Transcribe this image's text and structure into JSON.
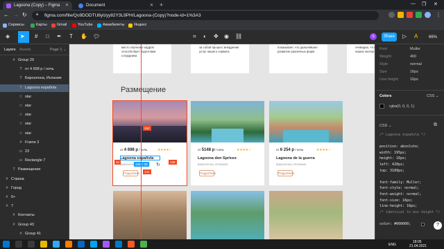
{
  "browser": {
    "tabs": [
      {
        "label": "Lagoona (Copy) – Figma",
        "active": true
      },
      {
        "label": "Document",
        "active": false
      }
    ],
    "new_tab": "+",
    "url": "figma.com/file/Qo9DODTU8ylzyy82Y3L9PH/Lagoona-(Copy)?node-id=1%3A3",
    "bookmarks": [
      "Сервисы",
      "Карты",
      "Gmail",
      "YouTube",
      "Авиабилеты",
      "Яндекс"
    ],
    "window_controls": [
      "—",
      "❐",
      "✕"
    ]
  },
  "figma": {
    "share_label": "Share",
    "zoom": "66%",
    "avatar_letter": "S"
  },
  "layers_panel": {
    "tab_layers": "Layers",
    "tab_assets": "Assets",
    "page": "Page 1 ⌄",
    "items": [
      {
        "icon": "#",
        "name": "Group 29",
        "indent": 1,
        "selected": false
      },
      {
        "icon": "T",
        "name": "от 4 698 р / ночь",
        "indent": 2,
        "selected": false
      },
      {
        "icon": "T",
        "name": "Барселона, Испания",
        "indent": 2,
        "selected": false
      },
      {
        "icon": "T",
        "name": "Lagoona españolа",
        "indent": 2,
        "selected": true
      },
      {
        "icon": "☆",
        "name": "star",
        "indent": 2,
        "selected": false
      },
      {
        "icon": "☆",
        "name": "star",
        "indent": 2,
        "selected": false
      },
      {
        "icon": "☆",
        "name": "star",
        "indent": 2,
        "selected": false
      },
      {
        "icon": "☆",
        "name": "star",
        "indent": 2,
        "selected": false
      },
      {
        "icon": "☆",
        "name": "star",
        "indent": 2,
        "selected": false
      },
      {
        "icon": "#",
        "name": "Frame 2",
        "indent": 2,
        "selected": false
      },
      {
        "icon": "▭",
        "name": "23",
        "indent": 2,
        "selected": false
      },
      {
        "icon": "▭",
        "name": "Rectangle 7",
        "indent": 2,
        "selected": false
      },
      {
        "icon": "T",
        "name": "Размещение",
        "indent": 1,
        "selected": false
      },
      {
        "icon": "#",
        "name": "Страна",
        "indent": 0,
        "selected": false
      },
      {
        "icon": "#",
        "name": "Город",
        "indent": 0,
        "selected": false
      },
      {
        "icon": "#",
        "name": "6+",
        "indent": 0,
        "selected": false
      },
      {
        "icon": "#",
        "name": "7",
        "indent": 0,
        "selected": false
      },
      {
        "icon": "#",
        "name": "Контакты",
        "indent": 1,
        "selected": false
      },
      {
        "icon": "#",
        "name": "Group 43",
        "indent": 1,
        "selected": false
      },
      {
        "icon": "#",
        "name": "Group 41",
        "indent": 2,
        "selected": false
      }
    ]
  },
  "canvas": {
    "top_cards": [
      "Раннее обучение равных и место обучение кадров способствует подготовки сотрудника",
      "Консультация с активом влечет за собой процесс внедрения услуг нашего сервиса",
      "Повседневная практика показывает, что дальнейшее развитие различных форм",
      "Значимость этого настолько очевидна, что консультация наших экспертов помогает"
    ],
    "section_title": "Размещение",
    "hotels": [
      {
        "price_prefix": "от",
        "price": "4 698 р",
        "per": "/ ночь",
        "name": "Lagoona españolа",
        "location": "Барселона, Испания",
        "button": "Подробнее"
      },
      {
        "price_prefix": "от",
        "price": "5148 р",
        "per": "/ ночь",
        "name": "Lagoona don Sprices",
        "location": "Барселона, Испания",
        "button": "Подробнее"
      },
      {
        "price_prefix": "от",
        "price": "6 254 р",
        "per": "/ ночь",
        "name": "Lagoona de la guerra",
        "location": "Барселона, Испания",
        "button": "Подробнее"
      }
    ],
    "selection_size": "195 × 38",
    "measure_labels": [
      "262",
      "40",
      "138",
      "131"
    ]
  },
  "inspector": {
    "font_rows": [
      {
        "k": "Font",
        "v": "Muller"
      },
      {
        "k": "Weight",
        "v": "400"
      },
      {
        "k": "Style",
        "v": "normal"
      },
      {
        "k": "Size",
        "v": "16px"
      },
      {
        "k": "Line height",
        "v": "16px"
      }
    ],
    "colors_heading": "Colors",
    "colors_format": "CSS ⌄",
    "color_value": "rgba(0, 0, 0, 1)",
    "css_heading": "CSS ⌄",
    "css_lines": [
      "/* Lagoona españolа */",
      "",
      "position: absolute;",
      "width: 195px;",
      "height: 16px;",
      "left: 420px;",
      "top: 3189px;",
      "",
      "font-family: Muller;",
      "font-style: normal;",
      "font-weight: normal;",
      "font-size: 16px;",
      "line-height: 16px;",
      "/* identical to box height */",
      "",
      "color: #000000;"
    ]
  },
  "taskbar": {
    "lang": "ENG",
    "time": "18:05",
    "date": "21.04.2021"
  },
  "colors": {
    "figma_blue": "#18a0fb",
    "accent_orange": "#e0a480",
    "stars": "#f5a623",
    "measure_red": "#f24822"
  }
}
